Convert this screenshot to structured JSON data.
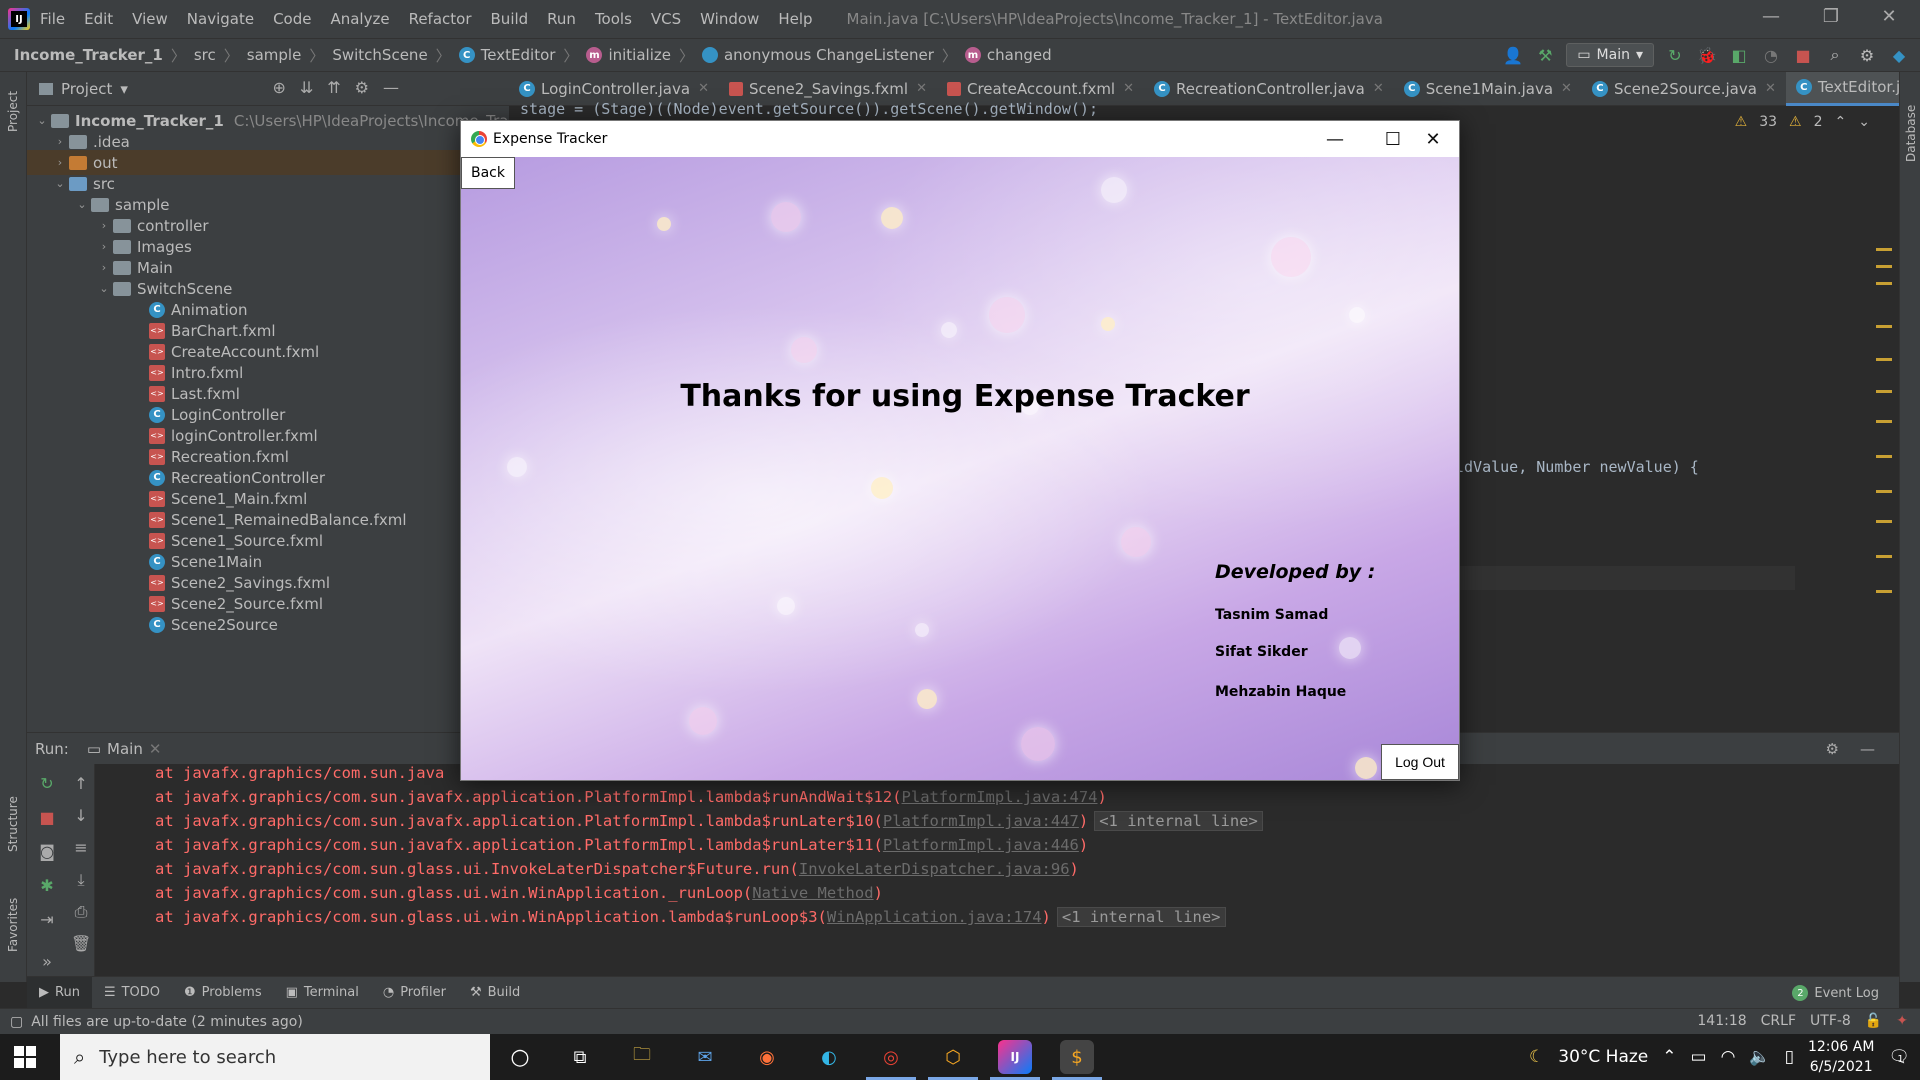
{
  "ide": {
    "menu": [
      "File",
      "Edit",
      "View",
      "Navigate",
      "Code",
      "Analyze",
      "Refactor",
      "Build",
      "Run",
      "Tools",
      "VCS",
      "Window",
      "Help"
    ],
    "window_title": "Main.java [C:\\Users\\HP\\IdeaProjects\\Income_Tracker_1] - TextEditor.java",
    "breadcrumbs": [
      "Income_Tracker_1",
      "src",
      "sample",
      "SwitchScene",
      "TextEditor",
      "initialize",
      "anonymous ChangeListener",
      "changed"
    ],
    "run_config": "Main",
    "project_header": "Project",
    "tree": {
      "root": "Income_Tracker_1",
      "root_path": "C:\\Users\\HP\\IdeaProjects\\Income_Trac",
      "idea": ".idea",
      "out": "out",
      "src": "src",
      "sample": "sample",
      "controller": "controller",
      "images": "Images",
      "main": "Main",
      "switchscene": "SwitchScene",
      "files": [
        "Animation",
        "BarChart.fxml",
        "CreateAccount.fxml",
        "Intro.fxml",
        "Last.fxml",
        "LoginController",
        "loginController.fxml",
        "Recreation.fxml",
        "RecreationController",
        "Scene1_Main.fxml",
        "Scene1_RemainedBalance.fxml",
        "Scene1_Source.fxml",
        "Scene1Main",
        "Scene2_Savings.fxml",
        "Scene2_Source.fxml",
        "Scene2Source"
      ]
    },
    "tabs": [
      "LoginController.java",
      "Scene2_Savings.fxml",
      "CreateAccount.fxml",
      "RecreationController.java",
      "Scene1Main.java",
      "Scene2Source.java",
      "TextEditor.java"
    ],
    "code_top": "stage = (Stage)((Node)event.getSource()).getScene().getWindow();",
    "code_mid": "ldValue, Number newValue) {",
    "warnings": "33",
    "weak_warnings": "2",
    "run_label": "Run:",
    "run_tab": "Main",
    "console": [
      "at javafx.graphics/com.sun.java",
      "at javafx.graphics/com.sun.javafx.application.PlatformImpl.lambda$runAndWait$12(",
      "at javafx.graphics/com.sun.javafx.application.PlatformImpl.lambda$runLater$10(",
      "at javafx.graphics/com.sun.javafx.application.PlatformImpl.lambda$runLater$11(",
      "at javafx.graphics/com.sun.glass.ui.InvokeLaterDispatcher$Future.run(",
      "at javafx.graphics/com.sun.glass.ui.win.WinApplication._runLoop(",
      "at javafx.graphics/com.sun.glass.ui.win.WinApplication.lambda$runLoop$3("
    ],
    "console_links": [
      "",
      "PlatformImpl.java:474",
      "PlatformImpl.java:447",
      "PlatformImpl.java:446",
      "InvokeLaterDispatcher.java:96",
      "Native Method",
      "WinApplication.java:174"
    ],
    "internal_line": "<1 internal line>",
    "tool_windows": [
      "Run",
      "TODO",
      "Problems",
      "Terminal",
      "Profiler",
      "Build"
    ],
    "event_log": "Event Log",
    "event_count": "2",
    "status_message": "All files are up-to-date (2 minutes ago)",
    "position": "141:18",
    "line_sep": "CRLF",
    "encoding": "UTF-8",
    "side_labels": [
      "Project",
      "Structure",
      "Favorites",
      "Database"
    ]
  },
  "app": {
    "title": "Expense Tracker",
    "back": "Back",
    "thanks": "Thanks for using Expense Tracker",
    "developed_by": "Developed by :",
    "developers": [
      "Tasnim Samad",
      "Sifat Sikder",
      "Mehzabin Haque"
    ],
    "logout": "Log Out"
  },
  "taskbar": {
    "search_placeholder": "Type here to search",
    "weather": "30°C Haze",
    "time": "12:06 AM",
    "date": "6/5/2021",
    "notifications": "1"
  },
  "colors": {
    "ide_bg": "#2b2b2b",
    "ide_panel": "#3c3f41",
    "error_text": "#ff6b68",
    "accent": "#4a88c7"
  }
}
